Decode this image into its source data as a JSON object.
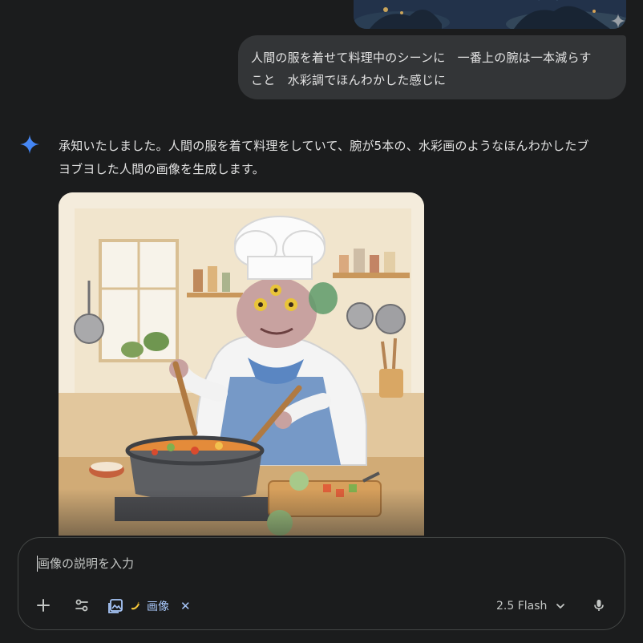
{
  "user_message": {
    "lines": [
      "人間の服を着せて料理中のシーンに　一番上の腕は一本減らす",
      "こと　水彩調でほんわかした感じに"
    ]
  },
  "response": {
    "lines": [
      "承知いたしました。人間の服を着て料理をしていて、腕が5本の、水彩画のようなほんわかしたブ",
      "ヨブヨした人間の画像を生成します。"
    ]
  },
  "composer": {
    "placeholder": "画像の説明を入力",
    "chip_label": "画像",
    "chip_close": "✕",
    "model_label": "2.5 Flash"
  },
  "icons": {
    "gemini": "gemini-sparkle-icon",
    "plus": "plus-icon",
    "tools": "tools-icon",
    "image_chip": "image-generate-icon",
    "banana": "banana-icon",
    "chevron": "chevron-down-icon",
    "mic": "microphone-icon"
  },
  "colors": {
    "background": "#1b1c1d",
    "bubble": "#333537",
    "accent": "#a8c7fa",
    "gemini_blue": "#4285f4"
  }
}
